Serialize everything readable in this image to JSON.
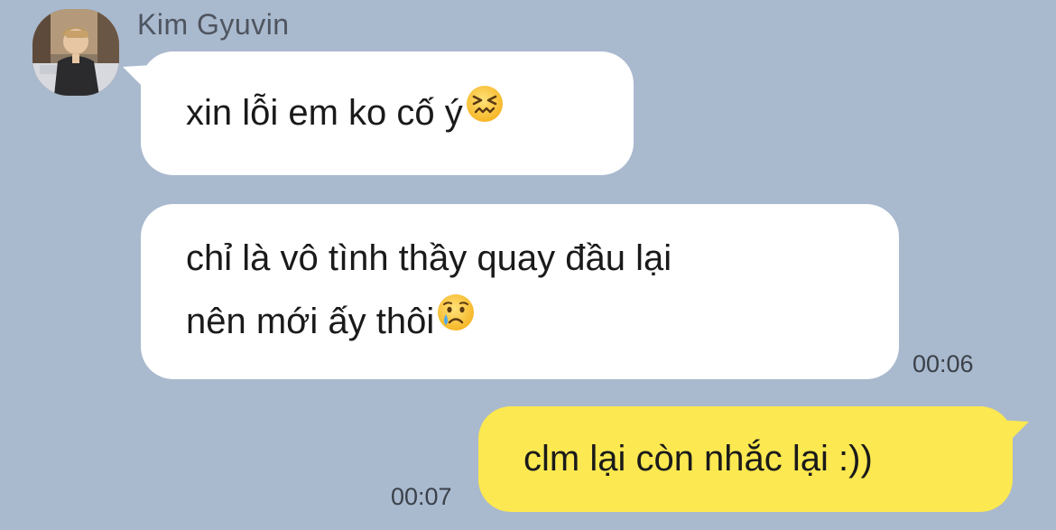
{
  "chat": {
    "sender_name": "Kim Gyuvin",
    "messages": [
      {
        "direction": "incoming",
        "text": "xin lỗi em ko cố ý",
        "emoji": "confounded-face-emoji"
      },
      {
        "direction": "incoming",
        "line1": "chỉ là vô tình thầy quay đầu lại",
        "line2": "nên mới ấy thôi",
        "emoji": "crying-face-emoji",
        "time": "00:06"
      },
      {
        "direction": "outgoing",
        "text": "clm lại còn nhắc lại :))",
        "time": "00:07"
      }
    ]
  },
  "colors": {
    "background": "#a9b9ce",
    "incoming_bubble": "#ffffff",
    "outgoing_bubble": "#fce850",
    "timestamp": "#3b4149",
    "sender_name": "#4e5560"
  }
}
